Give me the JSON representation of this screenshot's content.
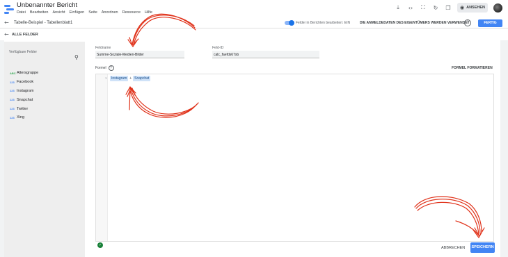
{
  "app": {
    "title": "Unbenannter Bericht",
    "menu": [
      "Datei",
      "Bearbeiten",
      "Ansicht",
      "Einfügen",
      "Seite",
      "Anordnen",
      "Ressource",
      "Hilfe"
    ],
    "view_label": "ANSEHEN",
    "icons": [
      "download-icon",
      "code-icon",
      "fullscreen-icon",
      "refresh-icon",
      "copy-icon",
      "eye-icon"
    ]
  },
  "toolbar": {
    "breadcrumb": "Tabelle-Beispiel - Tabellenblatt1",
    "toggle_label": "Felder in Berichten bearbeiten: EIN",
    "owner_text": "DIE ANMELDEDATEN DES EIGENTÜMERS WERDEN VERWENDET",
    "done_label": "FERTIG"
  },
  "section": {
    "back_label": "ALLE FELDER"
  },
  "panel": {
    "title": "Verfügbare Felder",
    "fields": [
      {
        "label": "Altersgruppe",
        "type": "dimension",
        "icon": "ABC"
      },
      {
        "label": "Facebook",
        "type": "metric",
        "icon": "123"
      },
      {
        "label": "Instagram",
        "type": "metric",
        "icon": "123"
      },
      {
        "label": "Snapchat",
        "type": "metric",
        "icon": "123"
      },
      {
        "label": "Twitter",
        "type": "metric",
        "icon": "123"
      },
      {
        "label": "Xing",
        "type": "metric",
        "icon": "123"
      }
    ]
  },
  "editor": {
    "field_name_label": "Feldname",
    "field_name_value": "Summe-Soziale-Medien-Bilder",
    "field_id_label": "Feld-ID",
    "field_id_value": "calc_faefds67xb",
    "formula_label": "Formel",
    "format_label": "FORMEL FORMATIEREN",
    "line_number": "1",
    "formula_tokens": [
      "Instagram",
      "+",
      "Snapchat"
    ],
    "cancel_label": "ABBRECHEN",
    "save_label": "SPEICHERN"
  },
  "colors": {
    "accent": "#4285f4",
    "annotation": "#e0321a",
    "valid": "#188038"
  }
}
